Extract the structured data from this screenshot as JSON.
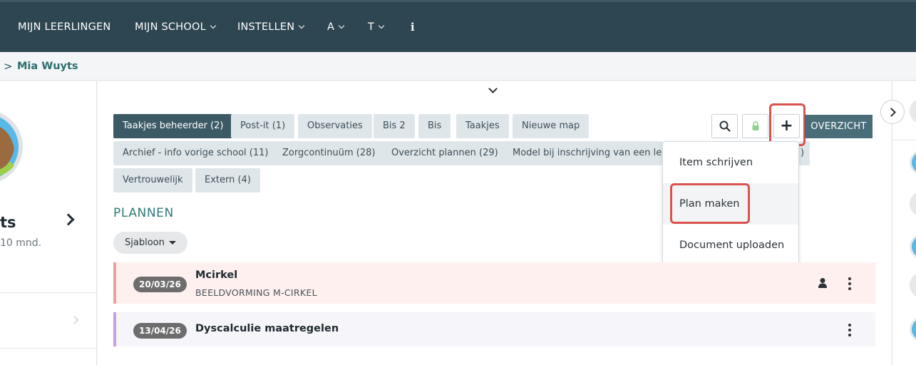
{
  "nav": {
    "items": [
      {
        "label": "MIJN LEERLINGEN",
        "dropdown": false
      },
      {
        "label": "MIJN SCHOOL",
        "dropdown": true
      },
      {
        "label": "INSTELLEN",
        "dropdown": true
      },
      {
        "label": "A",
        "dropdown": true
      },
      {
        "label": "T",
        "dropdown": true
      }
    ],
    "info_label": "i"
  },
  "breadcrumb": {
    "arrow": ">",
    "student_name": "Mia Wuyts"
  },
  "left_panel": {
    "name_fragment": "ts",
    "age_fragment": "10 mnd."
  },
  "tags": [
    "Taakjes beheerder (2)",
    "Post-it (1)",
    "Observaties",
    "Bis 2",
    "Bis",
    "Taakjes",
    "Nieuwe map",
    "Archief - info vorige school (11)",
    "Zorgcontinuüm (28)",
    "Overzicht plannen (29)",
    "Model bij inschrijving van een leerl",
    "Vertrouwelijk",
    "Extern (4)"
  ],
  "tag_row2_tail": ")",
  "toolbar": {
    "overzicht_label": "OVERZICHT",
    "add_label": "+"
  },
  "dropdown_menu": {
    "items": [
      "Item schrijven",
      "Plan maken",
      "Document uploaden"
    ],
    "highlighted": "Plan maken"
  },
  "section": {
    "title": "PLANNEN"
  },
  "filter": {
    "sjabloon_label": "Sjabloon"
  },
  "plans": [
    {
      "date": "20/03/26",
      "title": "Mcirkel",
      "subtitle": "BEELDVORMING M-CIRKEL",
      "accent": "#e8a39b",
      "bg": "#fdf0ef"
    },
    {
      "date": "13/04/26",
      "title": "Dyscalculie maatregelen",
      "subtitle": "",
      "accent": "#c9a0e0",
      "bg": "#f6f6fa"
    }
  ],
  "colors": {
    "nav_bg": "#2e4651",
    "accent_green": "#2e7a78",
    "highlight_red": "#d9534f"
  }
}
